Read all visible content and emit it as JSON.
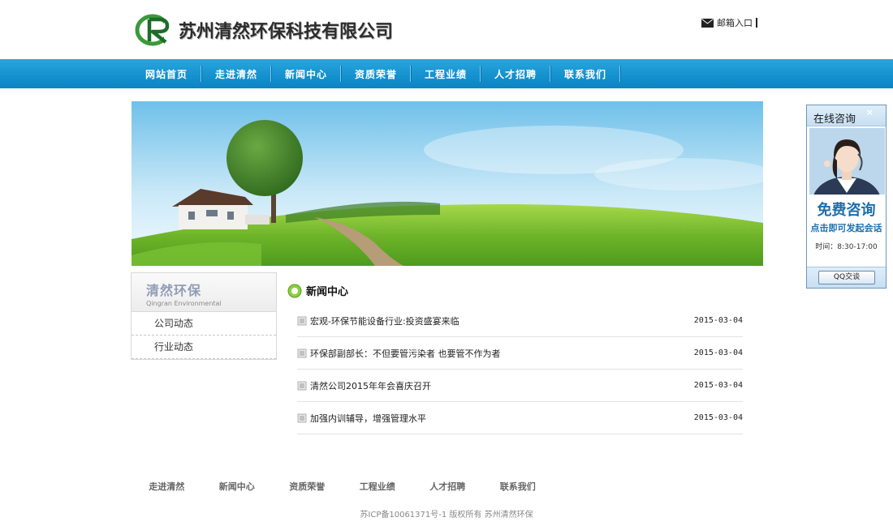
{
  "header": {
    "company_name": "苏州清然环保科技有限公司",
    "mail_label": "邮箱入口"
  },
  "nav": {
    "items": [
      {
        "label": "网站首页"
      },
      {
        "label": "走进清然"
      },
      {
        "label": "新闻中心"
      },
      {
        "label": "资质荣誉"
      },
      {
        "label": "工程业绩"
      },
      {
        "label": "人才招聘"
      },
      {
        "label": "联系我们"
      }
    ]
  },
  "sidebar": {
    "title": "清然环保",
    "subtitle": "Qingran Environmental",
    "items": [
      {
        "label": "公司动态"
      },
      {
        "label": "行业动态"
      }
    ]
  },
  "news": {
    "heading": "新闻中心",
    "items": [
      {
        "title": "宏观-环保节能设备行业:投资盛宴来临",
        "date": "2015-03-04"
      },
      {
        "title": "环保部副部长：不但要管污染者 也要管不作为者",
        "date": "2015-03-04"
      },
      {
        "title": "清然公司2015年年会喜庆召开",
        "date": "2015-03-04"
      },
      {
        "title": "加强内训辅导，增强管理水平",
        "date": "2015-03-04"
      }
    ]
  },
  "footer": {
    "items": [
      {
        "label": "走进清然"
      },
      {
        "label": "新闻中心"
      },
      {
        "label": "资质荣誉"
      },
      {
        "label": "工程业绩"
      },
      {
        "label": "人才招聘"
      },
      {
        "label": "联系我们"
      }
    ],
    "copyright": "苏ICP备10061371号-1 版权所有 苏州清然环保"
  },
  "consult": {
    "title": "在线咨询",
    "close": "×",
    "big_text": "免费咨询",
    "small_text": "点击即可发起会话",
    "hours": "时间：8:30-17:00",
    "qq_button": "QQ交谈"
  },
  "colors": {
    "nav_blue": "#1592cf",
    "logo_green": "#3a9a3a",
    "consult_blue": "#1b6fae"
  }
}
